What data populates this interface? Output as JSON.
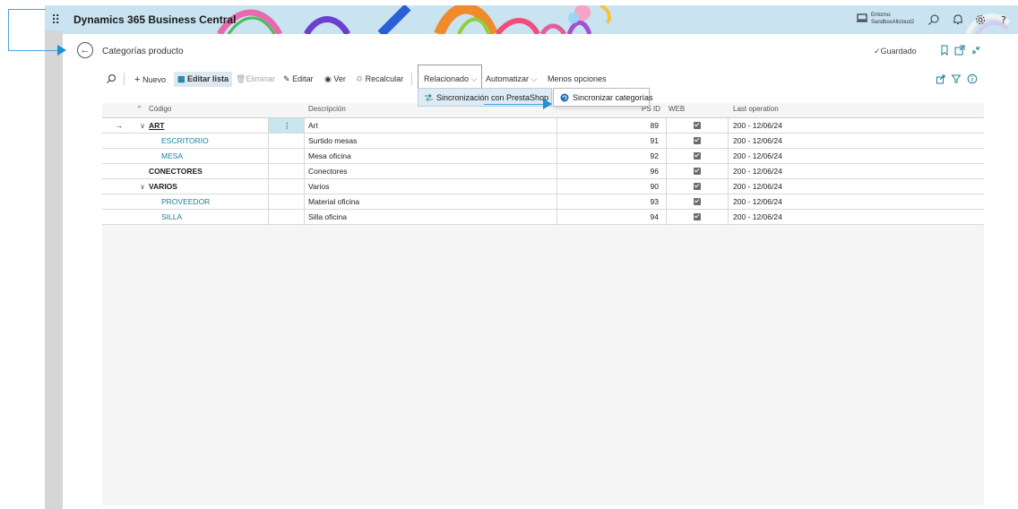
{
  "app": {
    "title": "Dynamics 365 Business Central",
    "environment_label": "Entorno:",
    "environment_value": "SandboxAllcloud2",
    "top_icons": [
      "search-icon",
      "bell-icon",
      "gear-icon",
      "help-icon"
    ]
  },
  "page": {
    "title": "Categorías producto",
    "saved_label": "Guardado",
    "header_icons": [
      "bookmark-icon",
      "open-new-window-icon",
      "collapse-icon"
    ]
  },
  "actions": {
    "nuevo": "Nuevo",
    "editar_lista": "Editar lista",
    "eliminar": "Eliminar",
    "editar": "Editar",
    "ver": "Ver",
    "recalcular": "Recalcular",
    "relacionado": "Relacionado",
    "automatizar": "Automatizar",
    "menos_opciones": "Menos opciones",
    "right_icons": [
      "share-icon",
      "filter-icon",
      "info-icon"
    ]
  },
  "menus": {
    "related_item": "Sincronización con PrestaShop",
    "submenu_item": "Sincronizar categorías"
  },
  "columns": {
    "codigo": "Código",
    "descripcion": "Descripción",
    "ps_id": "PS ID",
    "web": "WEB",
    "last_operation": "Last operation"
  },
  "rows": [
    {
      "code": "ART",
      "desc": "Art",
      "ps_id": "89",
      "web": true,
      "last": "200 - 12/06/24"
    },
    {
      "code": "ESCRITORIO",
      "desc": "Surtido mesas",
      "ps_id": "91",
      "web": true,
      "last": "200 - 12/06/24"
    },
    {
      "code": "MESA",
      "desc": "Mesa oficina",
      "ps_id": "92",
      "web": true,
      "last": "200 - 12/06/24"
    },
    {
      "code": "CONECTORES",
      "desc": "Conectores",
      "ps_id": "96",
      "web": true,
      "last": "200 - 12/06/24"
    },
    {
      "code": "VARIOS",
      "desc": "Varios",
      "ps_id": "90",
      "web": true,
      "last": "200 - 12/06/24"
    },
    {
      "code": "PROVEEDOR",
      "desc": "Material oficina",
      "ps_id": "93",
      "web": true,
      "last": "200 - 12/06/24"
    },
    {
      "code": "SILLA",
      "desc": "Silla oficina",
      "ps_id": "94",
      "web": true,
      "last": "200 - 12/06/24"
    }
  ],
  "colors": {
    "accent": "#1e90d6",
    "link": "#1b7f99",
    "topbar": "#c9e3f1"
  }
}
